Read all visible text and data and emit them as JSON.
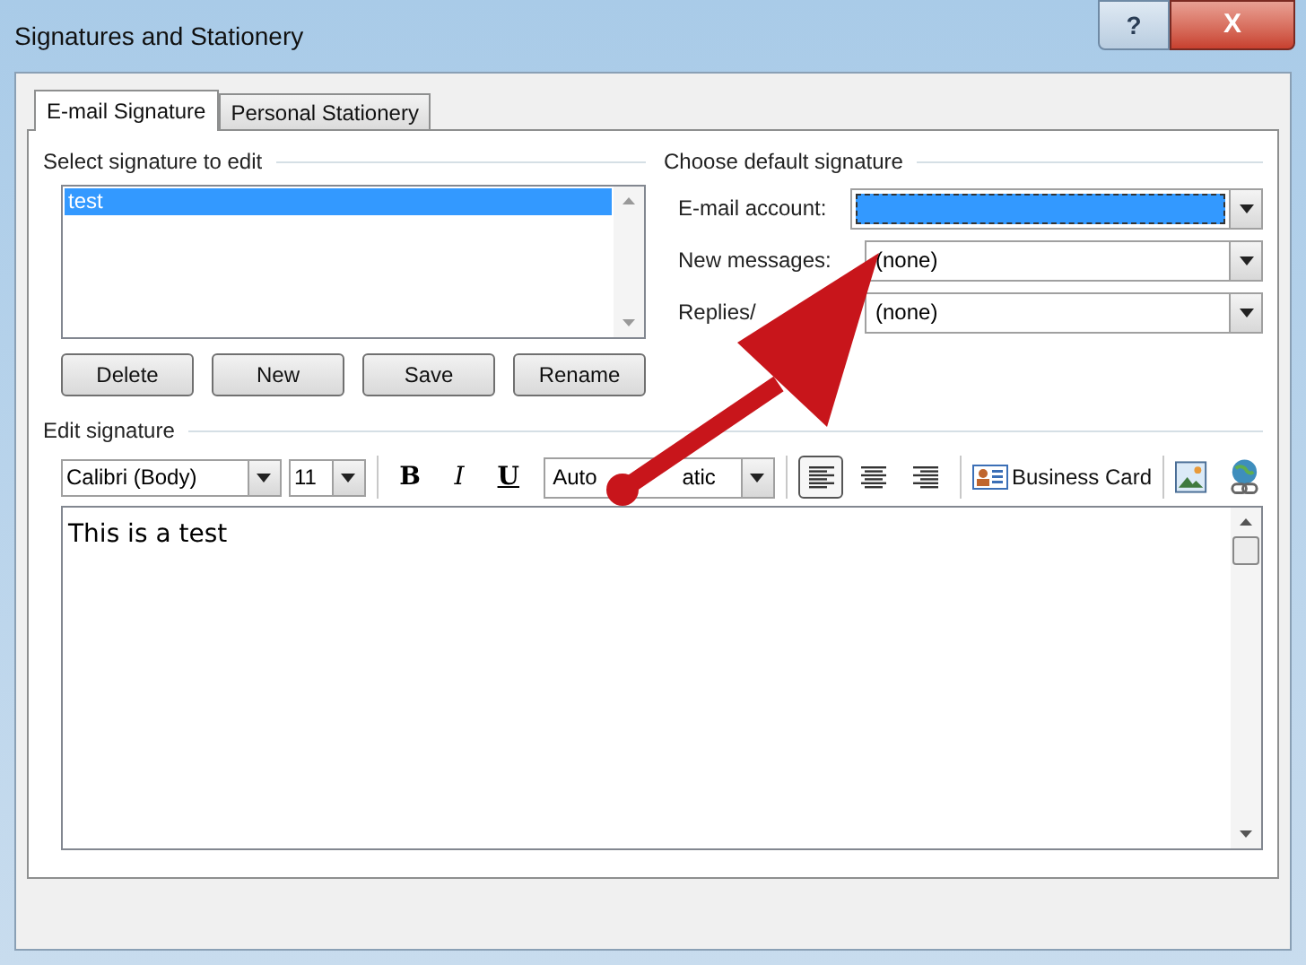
{
  "window": {
    "title": "Signatures and Stationery",
    "help_button": "?",
    "close_button": "X"
  },
  "tabs": [
    {
      "label": "E-mail Signature",
      "selected": true
    },
    {
      "label": "Personal Stationery",
      "selected": false
    }
  ],
  "select_signature": {
    "heading": "Select signature to edit",
    "items": [
      {
        "label": "test",
        "selected": true
      }
    ],
    "buttons": [
      "Delete",
      "New",
      "Save",
      "Rename"
    ]
  },
  "default_signature": {
    "heading": "Choose default signature",
    "fields": [
      {
        "label": "E-mail account:",
        "selected": true
      },
      {
        "label": "New messages:",
        "value": "(none)",
        "selected": false
      },
      {
        "label": "Replies/",
        "value": "(none)",
        "selected": false
      }
    ]
  },
  "edit_signature": {
    "heading": "Edit signature",
    "font": "Calibri (Body)",
    "size": "11",
    "bold": "B",
    "italic": "I",
    "underline": "U",
    "color_start": "Auto",
    "color_end": "atic",
    "business_card": "Business Card",
    "text": "This is a test"
  }
}
